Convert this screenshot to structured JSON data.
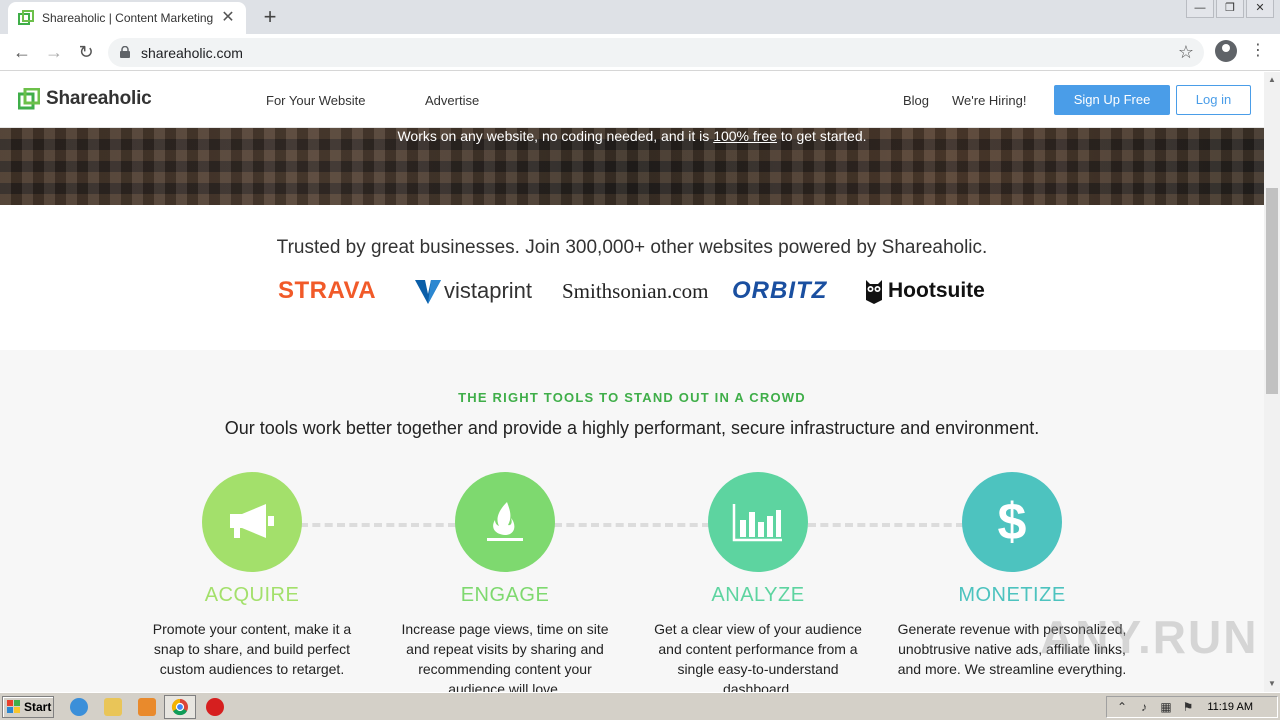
{
  "browser": {
    "tab_title": "Shareaholic | Content Marketing Plat",
    "tab_close": "✕",
    "new_tab": "+",
    "url": "shareaholic.com",
    "win_min": "—",
    "win_restore": "❐",
    "win_close": "✕"
  },
  "header": {
    "logo_text": "Shareaholic",
    "nav": [
      "For Your Website",
      "Advertise",
      "Blog",
      "We're Hiring!"
    ],
    "signup_label": "Sign Up Free",
    "login_label": "Log in"
  },
  "hero": {
    "text_before": "Works on any website, no coding needed, and it is ",
    "text_link": "100% free",
    "text_after": " to get started."
  },
  "trusted": {
    "text": "Trusted by great businesses. Join 300,000+ other websites powered by Shareaholic.",
    "brands": [
      "STRAVA",
      "vistaprint",
      "Smithsonian.com",
      "ORBITZ",
      "Hootsuite"
    ]
  },
  "tools": {
    "kicker": "THE RIGHT TOOLS TO STAND OUT IN A CROWD",
    "heading": "Our tools work better together and provide a highly performant, secure infrastructure and environment.",
    "features": [
      {
        "title": "ACQUIRE",
        "icon": "megaphone-icon",
        "color": "#a3e06b",
        "desc": "Promote your content, make it a snap to share, and build perfect custom audiences to retarget."
      },
      {
        "title": "ENGAGE",
        "icon": "flame-icon",
        "color": "#7ed96f",
        "desc": "Increase page views, time on site and repeat visits by sharing and recommending content your audience will love."
      },
      {
        "title": "ANALYZE",
        "icon": "bar-chart-icon",
        "color": "#5dd4a0",
        "desc": "Get a clear view of your audience and content performance from a single easy-to-understand dashboard."
      },
      {
        "title": "MONETIZE",
        "icon": "dollar-icon",
        "color": "#4dc3bf",
        "desc": "Generate revenue with personalized, unobtrusive native ads, affiliate links, and more. We streamline everything."
      }
    ]
  },
  "taskbar": {
    "start_label": "Start",
    "clock": "11:19 AM"
  },
  "watermark": "ANY.RUN"
}
